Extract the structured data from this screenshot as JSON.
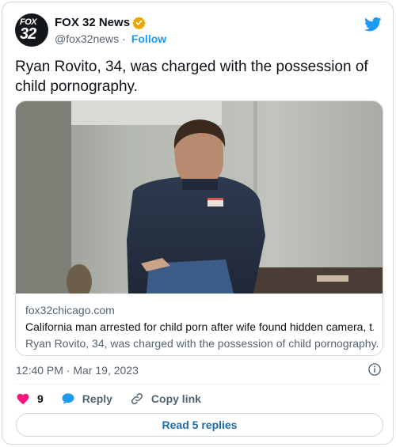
{
  "author": {
    "avatar_text_top": "FOX",
    "avatar_text_bottom": "32",
    "display_name": "FOX 32 News",
    "handle": "@fox32news",
    "follow_label": "Follow",
    "verified_icon": "verified-badge-icon",
    "verified_color": "#e8a600"
  },
  "tweet": {
    "text": "Ryan Rovito, 34, was charged with the possession of child pornography."
  },
  "link_card": {
    "image": "photo of seated man in navy sweater with hands behind back",
    "domain": "fox32chicago.com",
    "title": "California man arrested for child porn after wife found hidden camera, t...",
    "description": "Ryan Rovito, 34, was charged with the possession of child pornography."
  },
  "meta": {
    "timestamp": "12:40 PM · Mar 19, 2023"
  },
  "actions": {
    "like_count": "9",
    "reply_label": "Reply",
    "copy_link_label": "Copy link"
  },
  "footer": {
    "read_replies_label": "Read 5 replies"
  },
  "colors": {
    "twitter_blue": "#1d9bf0",
    "like_pink": "#f91880",
    "text_secondary": "#536471",
    "border": "#cfd9de"
  }
}
